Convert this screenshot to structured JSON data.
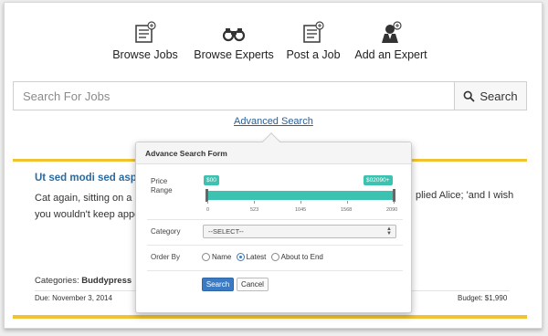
{
  "nav": {
    "items": [
      {
        "label": "Browse Jobs",
        "icon": "browse-jobs-icon"
      },
      {
        "label": "Browse Experts",
        "icon": "binoculars-icon"
      },
      {
        "label": "Post a Job",
        "icon": "post-job-icon"
      },
      {
        "label": "Add an Expert",
        "icon": "add-expert-icon"
      }
    ]
  },
  "search": {
    "placeholder": "Search For Jobs",
    "button_label": "Search",
    "advanced_link": "Advanced Search"
  },
  "job": {
    "title": "Ut sed modi sed asperi",
    "text_line1": "Cat again, sitting on a b",
    "text_line2": "you wouldn't keep appe",
    "text_right": "plied Alice; 'and I wish",
    "categories_label": "Categories:",
    "categories_value": "Buddypress",
    "due": "Due: November 3, 2014",
    "budget": "Budget: $1,990"
  },
  "advanced_form": {
    "title": "Advance Search Form",
    "price_label_1": "Price",
    "price_label_2": "Range",
    "min_tag": "$00",
    "max_tag": "$02090+",
    "range_min": 0,
    "range_max": 2090,
    "ticks": [
      "0",
      "523",
      "1045",
      "1568",
      "2090"
    ],
    "category_label": "Category",
    "category_selected": "--SELECT--",
    "order_label": "Order By",
    "order_options": [
      "Name",
      "Latest",
      "About to End"
    ],
    "order_selected": "Latest",
    "submit_label": "Search",
    "cancel_label": "Cancel"
  },
  "colors": {
    "accent_teal": "#3cc2b0",
    "accent_yellow": "#f2c233",
    "link_blue": "#2a5e94",
    "button_blue": "#3a7bc4"
  }
}
